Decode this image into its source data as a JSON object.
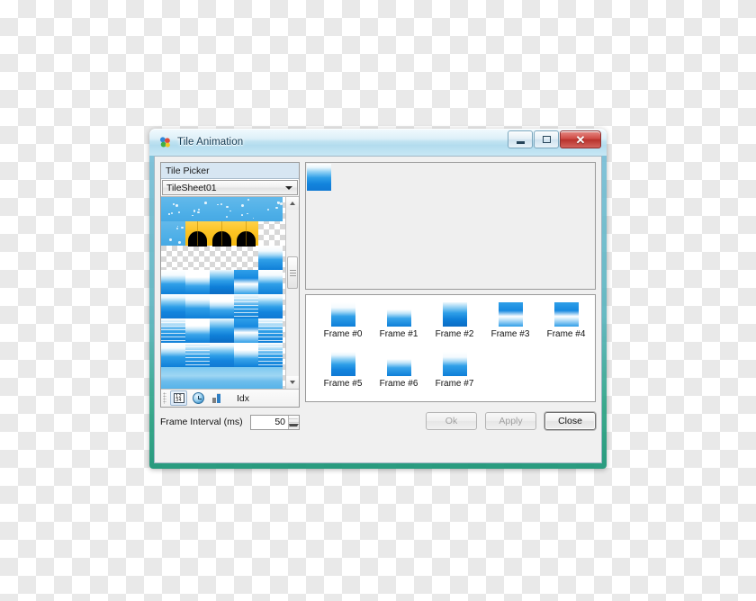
{
  "window": {
    "title": "Tile Animation",
    "icon": "tile-animation-icon",
    "buttons": {
      "minimize": "minimize-icon",
      "maximize": "maximize-icon",
      "close": "✕"
    }
  },
  "tile_picker": {
    "header": "Tile Picker",
    "sheet_selected": "TileSheet01",
    "sheet_options": [
      "TileSheet01"
    ],
    "toolbar": {
      "index_mode_icon": "number-grid-icon",
      "time_mode_icon": "clock-icon",
      "chart_icon": "bar-chart-icon",
      "label": "Idx"
    },
    "scrollbar": {
      "up": "▲",
      "down": "▼"
    }
  },
  "interval": {
    "label": "Frame Interval (ms)",
    "value": "50",
    "spinner_up": "▲",
    "spinner_down": "▼"
  },
  "preview": {
    "name": "animation-preview"
  },
  "frames": [
    {
      "label": "Frame #0"
    },
    {
      "label": "Frame #1"
    },
    {
      "label": "Frame #2"
    },
    {
      "label": "Frame #3"
    },
    {
      "label": "Frame #4"
    },
    {
      "label": "Frame #5"
    },
    {
      "label": "Frame #6"
    },
    {
      "label": "Frame #7"
    }
  ],
  "buttons": {
    "ok": "Ok",
    "apply": "Apply",
    "close": "Close",
    "ok_enabled": false,
    "apply_enabled": false,
    "close_enabled": true
  },
  "colors": {
    "titlebar": "#c3e4f2",
    "frame_glow": "#1e9678",
    "close_button": "#cf4c46",
    "picker_header": "#d7e6f2",
    "water_blue": "#1384dd",
    "tile_gold": "#fcc425",
    "sky_blue": "#4fb0e8"
  }
}
